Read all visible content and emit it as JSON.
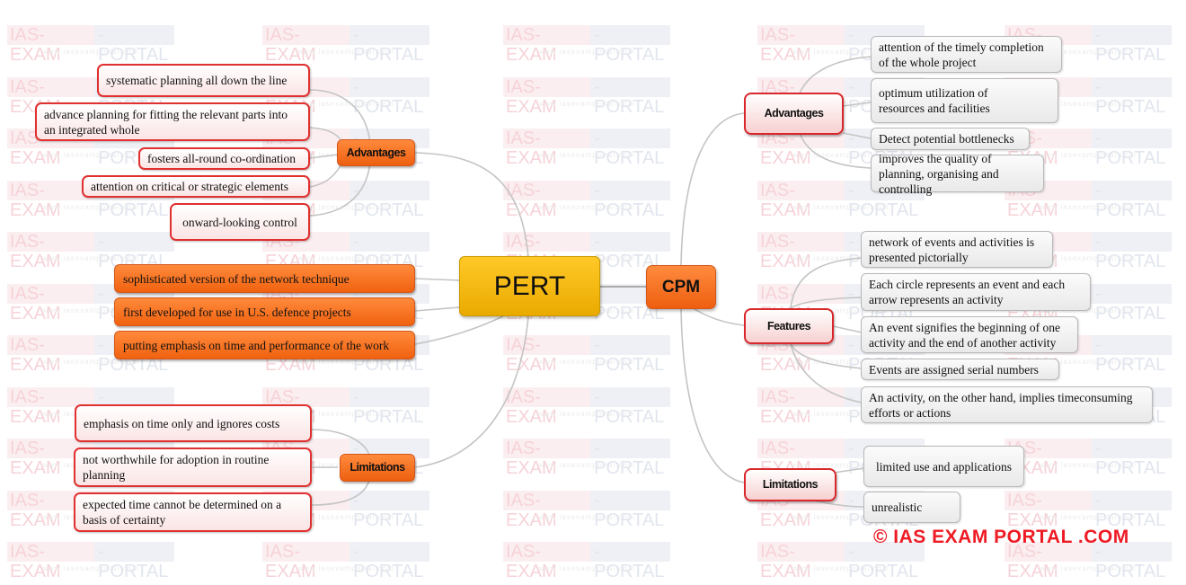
{
  "watermark": {
    "left": "IAS-EXAM",
    "right": "-PORTAL",
    "url": "www.iasexamportal.com"
  },
  "root": {
    "label": "PERT"
  },
  "pert": {
    "advantages": {
      "label": "Advantages",
      "items": [
        "systematic planning all down the line",
        "advance planning for fitting the relevant parts into an integrated whole",
        "fosters all-round co-ordination",
        "attention on critical or strategic elements",
        "onward-looking control"
      ]
    },
    "features": [
      "sophisticated version of the network technique",
      "first developed for use in U.S. defence projects",
      "putting emphasis on time and performance of the work"
    ],
    "limitations": {
      "label": "Limitations",
      "items": [
        "emphasis on time only and ignores costs",
        "not worthwhile for adoption in routine planning",
        "expected time cannot be determined on a basis of certainty"
      ]
    }
  },
  "cpm": {
    "label": "CPM",
    "advantages": {
      "label": "Advantages",
      "items": [
        "attention of the timely completion of the whole project",
        "optimum utilization of resources and facilities",
        "Detect potential bottlenecks",
        "improves the quality of planning, organising and controlling"
      ]
    },
    "features": {
      "label": "Features",
      "items": [
        "network of events and activities is presented pictorially",
        "Each circle represents an event and each arrow represents an activity",
        "An event signifies the beginning of one activity and the end of another activity",
        "Events are assigned serial numbers",
        "An activity, on the other hand, implies timeconsuming efforts or actions"
      ]
    },
    "limitations": {
      "label": "Limitations",
      "items": [
        "limited use and applications",
        "unrealistic"
      ]
    }
  },
  "copyright": "© IAS EXAM PORTAL .COM",
  "colors": {
    "root": "#f5b800",
    "branch_orange": "#f26b1d",
    "border_red": "#e0302f",
    "copyright_red": "#ee1b24"
  }
}
